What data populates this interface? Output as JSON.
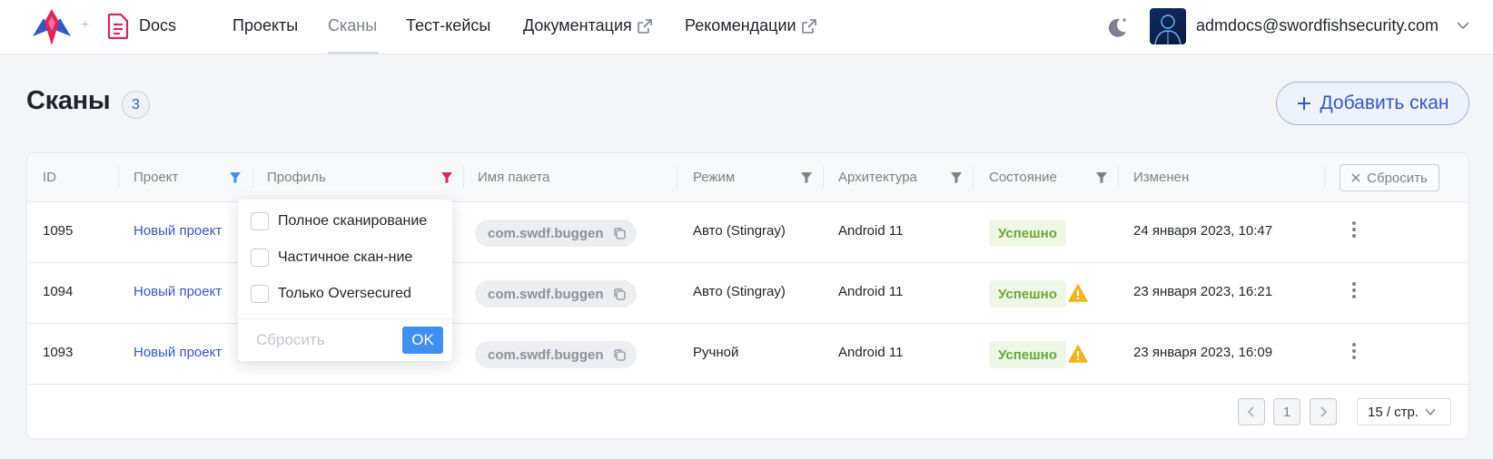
{
  "header": {
    "app_name": "Docs",
    "nav": [
      {
        "label": "Проекты"
      },
      {
        "label": "Сканы"
      },
      {
        "label": "Тест-кейсы"
      },
      {
        "label": "Документация"
      },
      {
        "label": "Рекомендации"
      }
    ],
    "user_email": "admdocs@swordfishsecurity.com"
  },
  "page": {
    "title": "Сканы",
    "count": "3",
    "add_button": "Добавить скан"
  },
  "table": {
    "columns": [
      "ID",
      "Проект",
      "Профиль",
      "Имя пакета",
      "Режим",
      "Архитектура",
      "Состояние",
      "Изменен"
    ],
    "reset_label": "Сбросить",
    "rows": [
      {
        "id": "1095",
        "project": "Новый проект",
        "package": "com.swdf.buggen",
        "mode": "Авто (Stingray)",
        "arch": "Android 11",
        "status": "Успешно",
        "changed": "24 января 2023, 10:47",
        "warning": false
      },
      {
        "id": "1094",
        "project": "Новый проект",
        "package": "com.swdf.buggen",
        "mode": "Авто (Stingray)",
        "arch": "Android 11",
        "status": "Успешно",
        "changed": "23 января 2023, 16:21",
        "warning": true
      },
      {
        "id": "1093",
        "project": "Новый проект",
        "package": "com.swdf.buggen",
        "mode": "Ручной",
        "arch": "Android 11",
        "status": "Успешно",
        "changed": "23 января 2023, 16:09",
        "warning": true
      }
    ]
  },
  "pagination": {
    "current_page": "1",
    "page_size": "15 / стр."
  },
  "profile_filter": {
    "options": [
      "Полное сканирование",
      "Частичное скан-ние",
      "Только Oversecured"
    ],
    "reset_label": "Сбросить",
    "ok_label": "OK"
  },
  "colors": {
    "accent": "#3556c8",
    "filter_active_project": "#3f8ff0",
    "filter_active_profile": "#e0245e",
    "success_text": "#6aa839",
    "warning": "#f2b41f"
  }
}
